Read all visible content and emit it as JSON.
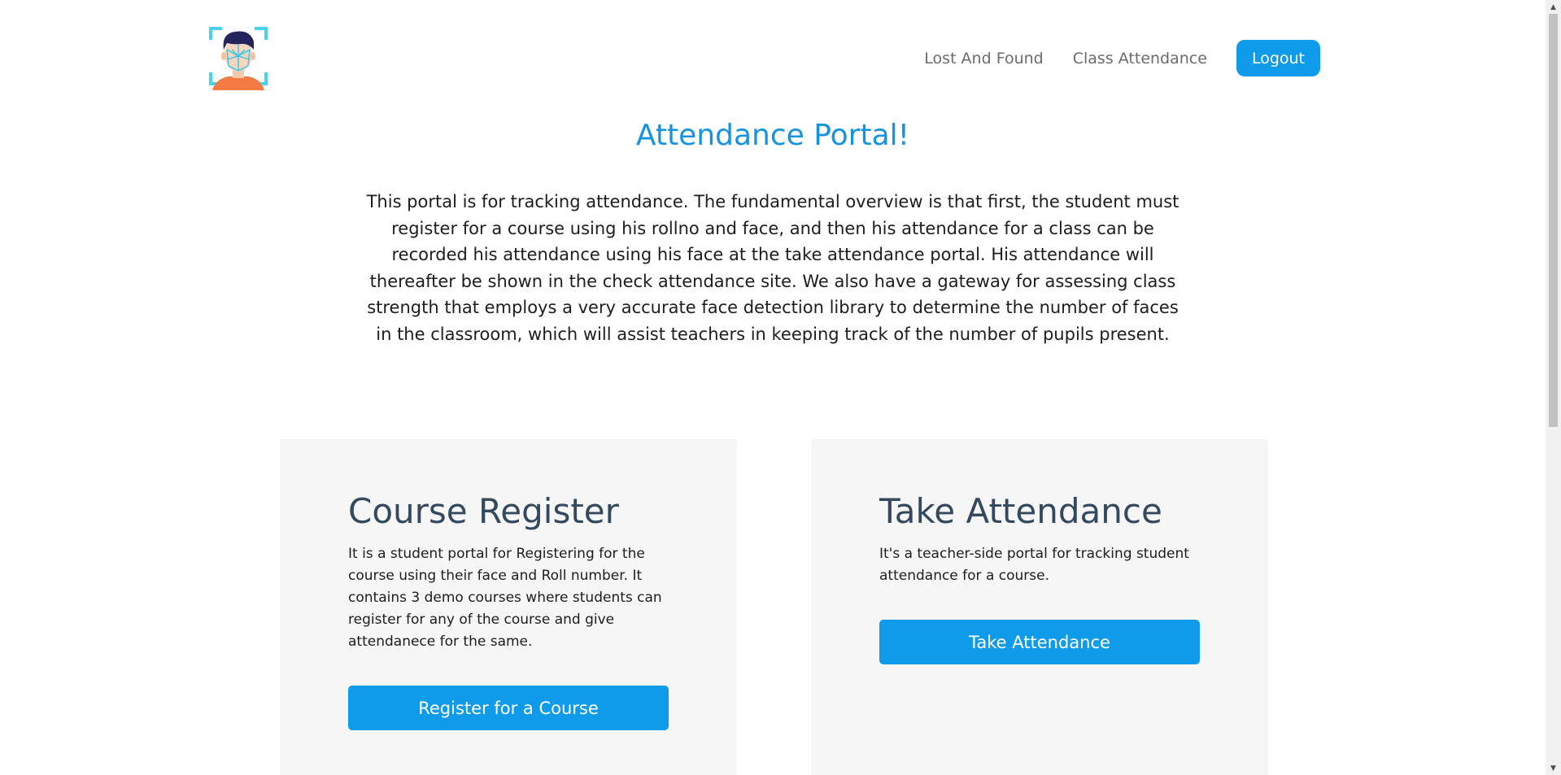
{
  "header": {
    "logo_icon": "face-scan-icon",
    "nav": [
      {
        "label": "Lost And Found"
      },
      {
        "label": "Class Attendance"
      }
    ],
    "logout_label": "Logout"
  },
  "main": {
    "title": "Attendance Portal!",
    "intro": "This portal is for tracking attendance. The fundamental overview is that first, the student must register for a course using his rollno and face, and then his attendance for a class can be recorded his attendance using his face at the take attendance portal. His attendance will thereafter be shown in the check attendance site. We also have a gateway for assessing class strength that employs a very accurate face detection library to determine the number of faces in the classroom, which will assist teachers in keeping track of the number of pupils present."
  },
  "cards": [
    {
      "title": "Course Register",
      "description": "It is a student portal for Registering for the course using their face and Roll number. It contains 3 demo courses where students can register for any of the course and give attendanece for the same.",
      "button_label": "Register for a Course"
    },
    {
      "title": "Take Attendance",
      "description": "It's a teacher-side portal for tracking student attendance for a course.",
      "button_label": "Take Attendance"
    }
  ],
  "colors": {
    "accent": "#109bea",
    "title": "#1493e0",
    "card_heading": "#34495e",
    "card_bg": "#f6f6f6"
  }
}
